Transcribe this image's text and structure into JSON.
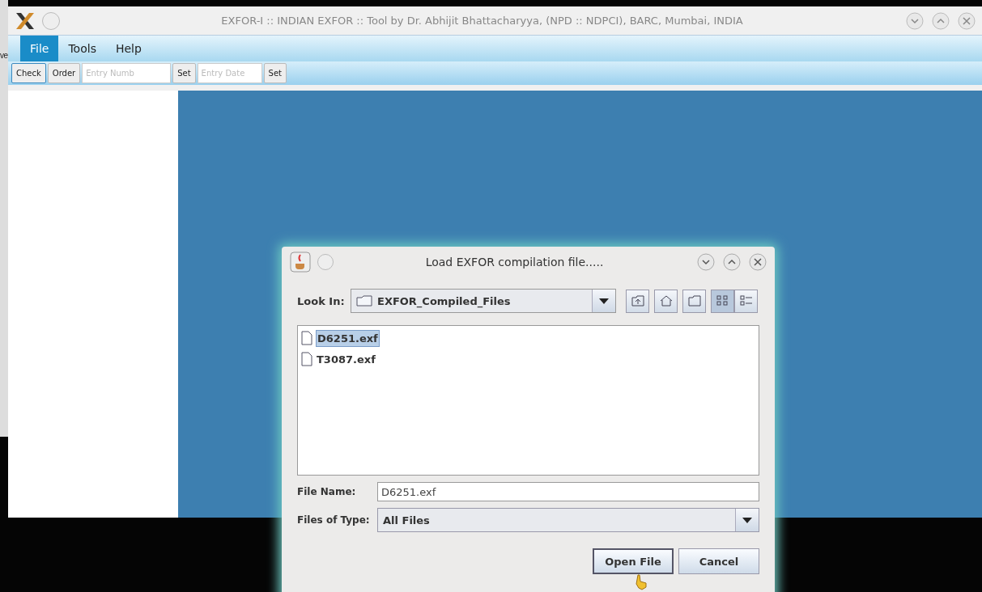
{
  "background_window": {
    "text": "ve"
  },
  "window": {
    "title": "EXFOR-I :: INDIAN EXFOR :: Tool by Dr. Abhijit Bhattacharyya, (NPD :: NDPCI), BARC, Mumbai, INDIA"
  },
  "menu": [
    {
      "label": "File",
      "selected": true
    },
    {
      "label": "Tools",
      "selected": false
    },
    {
      "label": "Help",
      "selected": false
    }
  ],
  "toolbar": [
    {
      "kind": "button",
      "label": "Check",
      "focused": true
    },
    {
      "kind": "button",
      "label": "Order",
      "focused": false
    },
    {
      "kind": "field",
      "placeholder": "Entry Numb"
    },
    {
      "kind": "button",
      "label": "Set",
      "focused": false
    },
    {
      "kind": "field",
      "placeholder": "Entry Date"
    },
    {
      "kind": "button",
      "label": "Set",
      "focused": false
    }
  ],
  "dialog": {
    "title": "Load EXFOR compilation file.....",
    "look_in": {
      "label": "Look In:",
      "value": "EXFOR_Compiled_Files"
    },
    "view_buttons": [
      {
        "kind": "up",
        "selected": false
      },
      {
        "kind": "home",
        "selected": false
      },
      {
        "kind": "new-folder",
        "selected": false
      },
      {
        "kind": "list",
        "selected": true
      },
      {
        "kind": "details",
        "selected": false
      }
    ],
    "files": [
      {
        "name": "D6251.exf",
        "selected": true
      },
      {
        "name": "T3087.exf",
        "selected": false
      }
    ],
    "file_name": {
      "label": "File Name:",
      "value": "D6251.exf"
    },
    "file_type": {
      "label": "Files of Type:",
      "value": "All Files"
    },
    "buttons": [
      {
        "label": "Open File",
        "default": true
      },
      {
        "label": "Cancel",
        "default": false
      }
    ]
  }
}
